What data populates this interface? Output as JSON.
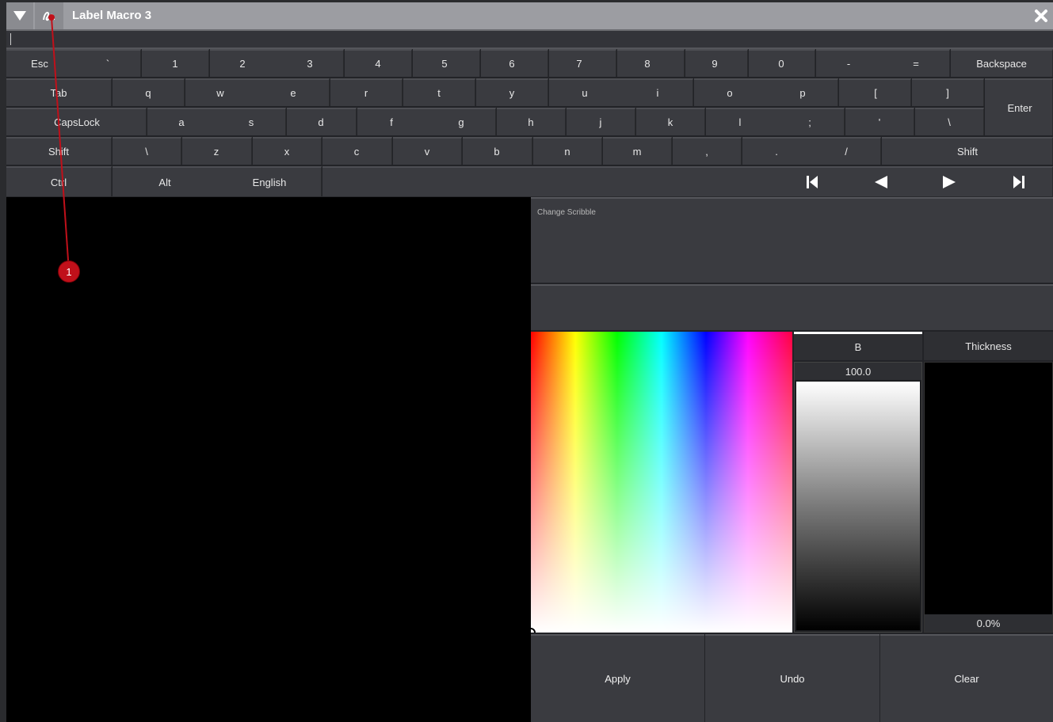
{
  "window": {
    "title": "Label Macro 3",
    "menu_icon": "triangle-down-icon",
    "scribble_icon": "scribble-icon",
    "close_icon": "close-icon"
  },
  "input": {
    "value": ""
  },
  "keyboard": {
    "row1": [
      "Esc",
      "`",
      "1",
      "2",
      "3",
      "4",
      "5",
      "6",
      "7",
      "8",
      "9",
      "0",
      "-",
      "=",
      "Backspace"
    ],
    "row2": [
      "Tab",
      "q",
      "w",
      "e",
      "r",
      "t",
      "y",
      "u",
      "i",
      "o",
      "p",
      "[",
      "]"
    ],
    "row3": [
      "CapsLock",
      "a",
      "s",
      "d",
      "f",
      "g",
      "h",
      "j",
      "k",
      "l",
      ";",
      "'",
      "\\"
    ],
    "row4": [
      "Shift",
      "\\",
      "z",
      "x",
      "c",
      "v",
      "b",
      "n",
      "m",
      ",",
      ".",
      "/",
      "Shift"
    ],
    "row5": [
      "Ctrl",
      "Alt",
      "English"
    ],
    "enter": "Enter",
    "nav": [
      "skip-to-start-icon",
      "previous-icon",
      "next-icon",
      "skip-to-end-icon"
    ]
  },
  "scribble": {
    "change_label": "Change Scribble"
  },
  "color": {
    "tab_b": "B",
    "tab_thickness": "Thickness",
    "b_value": "100.0",
    "thickness_value": "0.0%"
  },
  "actions": {
    "apply": "Apply",
    "undo": "Undo",
    "clear": "Clear"
  },
  "annotation": {
    "number": "1",
    "color": "#c0101a"
  }
}
